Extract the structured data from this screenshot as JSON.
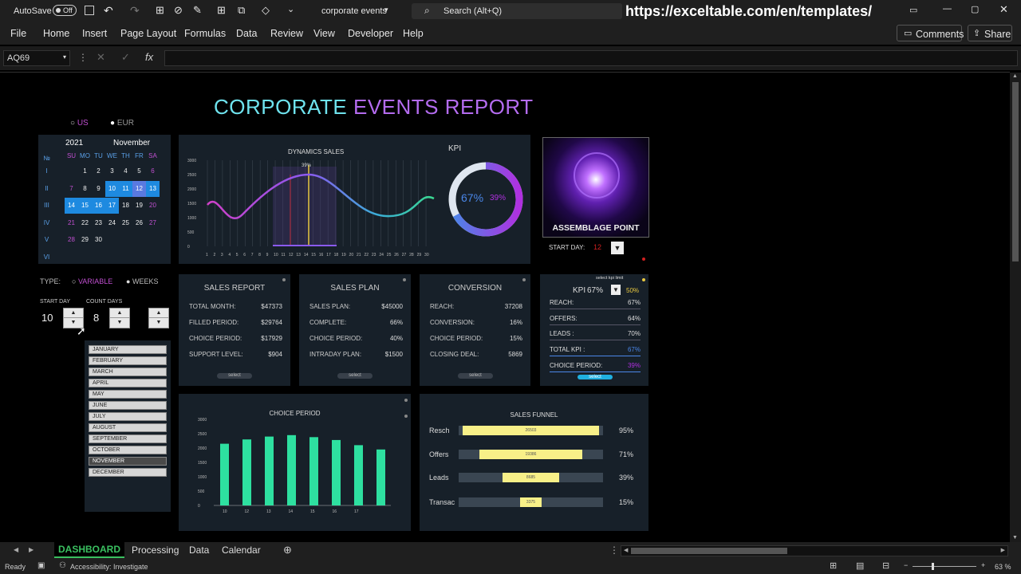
{
  "titlebar": {
    "autosave": "AutoSave",
    "toggle": "Off",
    "filename": "corporate events",
    "search": "Search (Alt+Q)",
    "url": "https://exceltable.com/en/templates/"
  },
  "menu": [
    "File",
    "Home",
    "Insert",
    "Page Layout",
    "Formulas",
    "Data",
    "Review",
    "View",
    "Developer",
    "Help"
  ],
  "ribbon_right": {
    "comments": "Comments",
    "share": "Share"
  },
  "namebox": "AQ69",
  "dashboard": {
    "title_parts": [
      "CORPORATE ",
      "EVENTS REPORT"
    ],
    "currency": [
      "US",
      "EUR"
    ],
    "calendar": {
      "year": "2021",
      "month": "November",
      "num": "№",
      "days": [
        "SU",
        "MO",
        "TU",
        "WE",
        "TH",
        "FR",
        "SA"
      ],
      "weeks": [
        "I",
        "II",
        "III",
        "IV",
        "V",
        "VI"
      ],
      "rows": [
        [
          "",
          "1",
          "2",
          "3",
          "4",
          "5",
          "6"
        ],
        [
          "7",
          "8",
          "9",
          "10",
          "11",
          "12",
          "13"
        ],
        [
          "14",
          "15",
          "16",
          "17",
          "18",
          "19",
          "20"
        ],
        [
          "21",
          "22",
          "23",
          "24",
          "25",
          "26",
          "27"
        ],
        [
          "28",
          "29",
          "30",
          "",
          "",
          "",
          ""
        ]
      ]
    },
    "type_label": "TYPE:",
    "type_opts": [
      "VARIABLE",
      "WEEKS"
    ],
    "start_day_label": "START DAY",
    "count_days_label": "COUNT DAYS",
    "start_day": "10",
    "count_days": "8",
    "months": [
      "JANUARY",
      "FEBRUARY",
      "MARCH",
      "APRIL",
      "MAY",
      "JUNE",
      "JULY",
      "AUGUST",
      "SEPTEMBER",
      "OCTOBER",
      "NOVEMBER",
      "DECEMBER"
    ],
    "dynamics": {
      "title": "DYNAMICS SALES",
      "peak": "39%",
      "yticks": [
        "0",
        "500",
        "1000",
        "1500",
        "2000",
        "2500",
        "3000"
      ],
      "xticks": [
        "1",
        "2",
        "3",
        "4",
        "5",
        "6",
        "7",
        "8",
        "9",
        "10",
        "11",
        "12",
        "13",
        "14",
        "15",
        "16",
        "17",
        "18",
        "19",
        "20",
        "21",
        "22",
        "23",
        "24",
        "25",
        "26",
        "27",
        "28",
        "29",
        "30"
      ]
    },
    "kpi": {
      "title": "KPI",
      "value": "67%",
      "sub": "39%"
    },
    "logo": "ASSEMBLAGE POINT",
    "start_day_box": {
      "label": "START DAY:",
      "value": "12"
    },
    "sales_report": {
      "title": "SALES REPORT",
      "rows": [
        [
          "TOTAL MONTH:",
          "$47373"
        ],
        [
          "FILLED PERIOD:",
          "$29764"
        ],
        [
          "CHOICE PERIOD:",
          "$17929"
        ],
        [
          "SUPPORT LEVEL:",
          "$904"
        ]
      ],
      "btn": "select"
    },
    "sales_plan": {
      "title": "SALES PLAN",
      "rows": [
        [
          "SALES PLAN:",
          "$45000"
        ],
        [
          "COMPLETE:",
          "66%"
        ],
        [
          "CHOICE PERIOD:",
          "40%"
        ],
        [
          "INTRADAY PLAN:",
          "$1500"
        ]
      ],
      "btn": "select"
    },
    "conversion": {
      "title": "CONVERSION",
      "rows": [
        [
          "REACH:",
          "37208"
        ],
        [
          "CONVERSION:",
          "16%"
        ],
        [
          "CHOICE PERIOD:",
          "15%"
        ],
        [
          "CLOSING DEAL:",
          "5869"
        ]
      ],
      "btn": "select"
    },
    "kpi_panel": {
      "limit": "select kpi limit",
      "kpi": "KPI",
      "kpi_val": "67%",
      "limit_val": "50%",
      "rows": [
        [
          "REACH:",
          "67%"
        ],
        [
          "OFFERS:",
          "64%"
        ],
        [
          "LEADS :",
          "70%"
        ],
        [
          "TOTAL KPI :",
          "67%"
        ],
        [
          "CHOICE PERIOD:",
          "39%"
        ]
      ],
      "btn": "select"
    },
    "choice": {
      "title": "CHOICE PERIOD",
      "yticks": [
        "0",
        "500",
        "1000",
        "1500",
        "2000",
        "2500",
        "3000"
      ]
    },
    "funnel": {
      "title": "SALES FUNNEL",
      "rows": [
        [
          "Resch",
          "26503",
          "95%"
        ],
        [
          "Offers",
          "19386",
          "71%"
        ],
        [
          "Leads",
          "8685",
          "39%"
        ],
        [
          "Transac",
          "3375",
          "15%"
        ]
      ]
    }
  },
  "sheets": [
    "DASHBOARD",
    "Processing",
    "Data",
    "Calendar"
  ],
  "status": {
    "ready": "Ready",
    "access": "Accessibility: Investigate",
    "zoom": "63 %"
  },
  "chart_data": [
    {
      "type": "bar",
      "title": "CHOICE PERIOD",
      "categories": [
        "10",
        "12",
        "13",
        "14",
        "15",
        "16",
        "17"
      ],
      "values": [
        2150,
        2300,
        2400,
        2450,
        2380,
        2280,
        2100,
        1950
      ],
      "ylim": [
        0,
        3000
      ]
    },
    {
      "type": "bar",
      "title": "SALES FUNNEL",
      "categories": [
        "Resch",
        "Offers",
        "Leads",
        "Transac"
      ],
      "values": [
        26503,
        19386,
        8685,
        3375
      ],
      "percent": [
        95,
        71,
        39,
        15
      ]
    }
  ]
}
